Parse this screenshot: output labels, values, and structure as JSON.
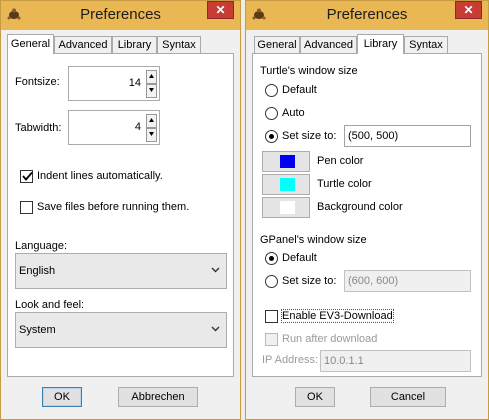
{
  "left": {
    "title": "Preferences",
    "tabs": [
      "General",
      "Advanced",
      "Library",
      "Syntax"
    ],
    "fontsize": {
      "label": "Fontsize:",
      "value": "14"
    },
    "tabwidth": {
      "label": "Tabwidth:",
      "value": "4"
    },
    "indent": {
      "label": "Indent lines automatically.",
      "checked": true
    },
    "savefiles": {
      "label": "Save files before running them.",
      "checked": false
    },
    "language": {
      "label": "Language:",
      "value": "English"
    },
    "lookfeel": {
      "label": "Look and feel:",
      "value": "System"
    },
    "ok": "OK",
    "cancel": "Abbrechen"
  },
  "right": {
    "title": "Preferences",
    "tabs": [
      "General",
      "Advanced",
      "Library",
      "Syntax"
    ],
    "turtle_heading": "Turtle's window size",
    "turtle_options": [
      "Default",
      "Auto",
      "Set size to:"
    ],
    "turtle_size_value": "(500, 500)",
    "pen_color_label": "Pen color",
    "turtle_color_label": "Turtle color",
    "background_color_label": "Background color",
    "colors": {
      "pen": "#0000ee",
      "turtle": "#00ffff",
      "background": "#ffffff"
    },
    "gpanel_heading": "GPanel's window size",
    "gpanel_options": [
      "Default",
      "Set size to:"
    ],
    "gpanel_size_value": "(600, 600)",
    "ev3_download": "Enable EV3-Download",
    "run_after_download": "Run after download",
    "ip_label": "IP Address:",
    "ip_value": "10.0.1.1",
    "ok": "OK",
    "cancel": "Cancel"
  },
  "icons": {
    "app": "turtle-icon",
    "close": "close-icon",
    "spin_up": "arrow-up-icon",
    "spin_down": "arrow-down-icon",
    "combo": "chevron-down-icon"
  }
}
